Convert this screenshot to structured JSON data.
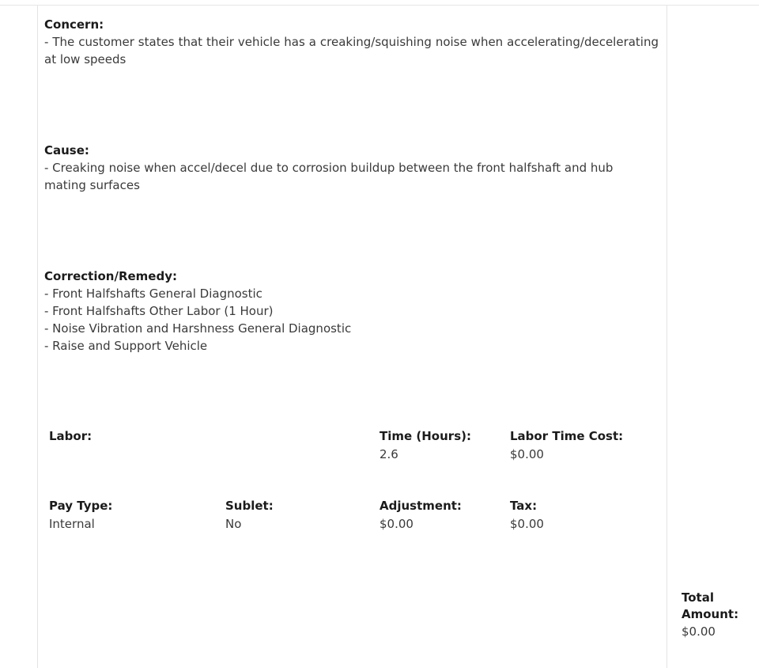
{
  "document": {
    "concern": {
      "heading": "Concern:",
      "text": "-  The  customer  states  that  their  vehicle  has  a  creaking/squishing  noise  when accelerating/decelerating at low speeds"
    },
    "cause": {
      "heading": "Cause:",
      "text": "- Creaking noise when accel/decel due to corrosion buildup between the front halfshaft and hub mating surfaces"
    },
    "correction": {
      "heading": "Correction/Remedy:",
      "items": [
        "- Front Halfshafts General Diagnostic",
        "- Front Halfshafts Other Labor (1 Hour)",
        "- Noise Vibration and Harshness General Diagnostic",
        "- Raise and Support Vehicle"
      ]
    },
    "labor_row": {
      "labor_label": "Labor:",
      "labor_value": "",
      "time_label": "Time (Hours):",
      "time_value": "2.6",
      "labor_time_cost_label": "Labor Time Cost:",
      "labor_time_cost_value": "$0.00"
    },
    "pay_row": {
      "pay_type_label": "Pay Type:",
      "pay_type_value": "Internal",
      "sublet_label": "Sublet:",
      "sublet_value": "No",
      "adjustment_label": "Adjustment:",
      "adjustment_value": "$0.00",
      "tax_label": "Tax:",
      "tax_value": "$0.00"
    },
    "total": {
      "label_line1": "Total",
      "label_line2": "Amount:",
      "value": "$0.00"
    }
  },
  "colors": {
    "heading": "#1b1b1b",
    "body": "#3a3a3a",
    "rule": "#e3e3e3",
    "background": "#ffffff"
  }
}
